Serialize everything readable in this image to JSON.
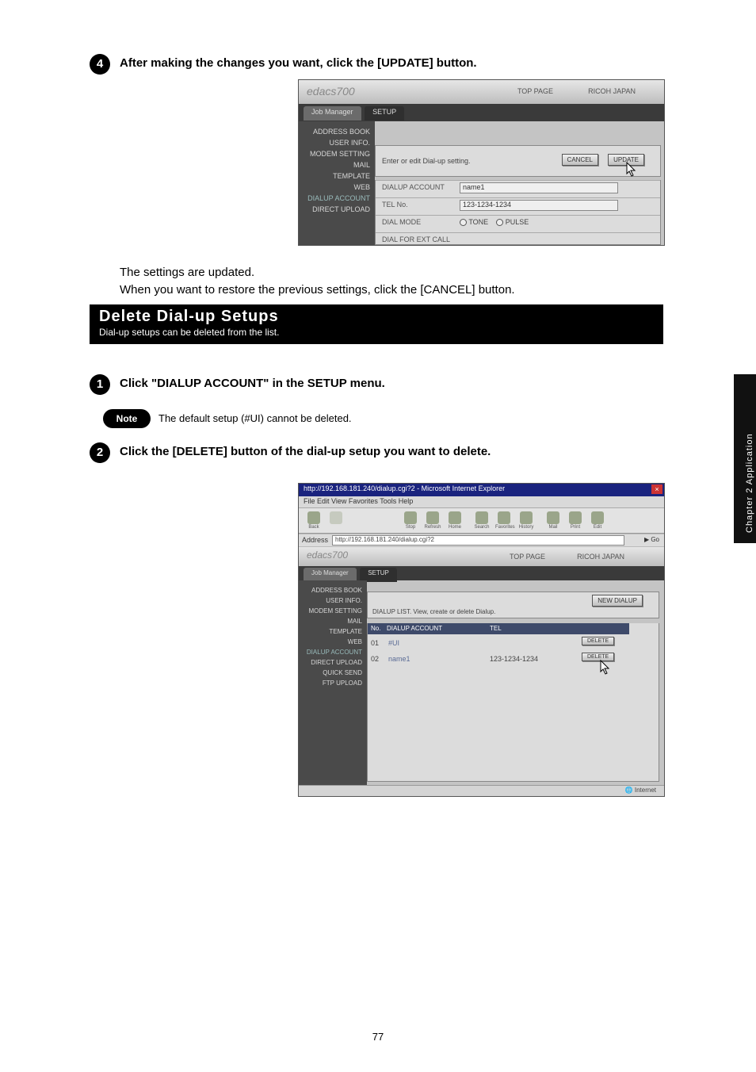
{
  "page_number": "77",
  "side_tab": "Chapter 2  Application",
  "step4": {
    "num": "4",
    "line1": "After making the changes you want, click the [UPDATE] button.",
    "line2": "The settings are updated.",
    "line3": "When you want to restore the previous settings, click the [CANCEL] button."
  },
  "heading": {
    "title": "Delete Dial-up Setups",
    "subtitle": "Dial-up setups can be deleted from the list."
  },
  "step1": {
    "num": "1",
    "main": "Click \"DIALUP ACCOUNT\" in the SETUP menu.",
    "note_label": "Note",
    "note_text": "The default setup (#UI) cannot be deleted."
  },
  "step2": {
    "num": "2",
    "main": "Click the [DELETE] button of the dial-up setup you want to delete."
  },
  "shot1": {
    "logo": "edacs700",
    "top1": "TOP PAGE",
    "top2": "RICOH JAPAN",
    "tab1": "Job Manager",
    "tab2": "SETUP",
    "sidebar": [
      "ADDRESS BOOK",
      "USER INFO.",
      "MODEM SETTING",
      "",
      "MAIL",
      "TEMPLATE",
      "WEB",
      "DIALUP ACCOUNT",
      "DIRECT UPLOAD"
    ],
    "content_title": "Enter or edit Dial-up setting.",
    "btn_cancel": "CANCEL",
    "btn_update": "UPDATE",
    "row1_label": "DIALUP ACCOUNT",
    "row1_value": "name1",
    "row2_label": "TEL No.",
    "row2_value": "123-1234-1234",
    "row3_label": "DIAL MODE",
    "row3_opt1": "TONE",
    "row3_opt2": "PULSE",
    "row4_label": "DIAL FOR EXT CALL"
  },
  "shot2": {
    "window_title": "http://192.168.181.240/dialup.cgi?2 - Microsoft Internet Explorer",
    "menus": "File   Edit   View   Favorites   Tools   Help",
    "toolbar": [
      "Back",
      "",
      "Stop",
      "Refresh",
      "Home",
      "Search",
      "Favorites",
      "History",
      "Mail",
      "Print",
      "Edit"
    ],
    "addr_label": "Address",
    "addr_value": "http://192.168.181.240/dialup.cgi?2",
    "go": "Go",
    "logo": "edacs700",
    "top1": "TOP PAGE",
    "top2": "RICOH JAPAN",
    "tab1": "Job Manager",
    "tab2": "SETUP",
    "sidebar": [
      "ADDRESS BOOK",
      "USER INFO.",
      "MODEM SETTING",
      "",
      "MAIL",
      "TEMPLATE",
      "WEB",
      "DIALUP ACCOUNT",
      "DIRECT UPLOAD",
      "QUICK SEND",
      "FTP UPLOAD"
    ],
    "btn_new": "NEW DIALUP",
    "content_title": "DIALUP LIST. View, create or delete Dialup.",
    "th_no": "No.",
    "th_acct": "DIALUP ACCOUNT",
    "th_tel": "TEL",
    "td_no1": "01",
    "td_acct1": "#UI",
    "td_del1": "DELETE",
    "td_no2": "02",
    "td_acct2": "name1",
    "td_tel2": "123-1234-1234",
    "td_del2": "DELETE",
    "status": "Internet"
  }
}
